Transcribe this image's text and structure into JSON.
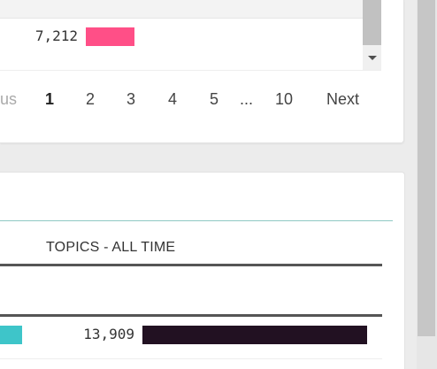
{
  "top_table": {
    "row": {
      "value": "7,212",
      "bar_fraction": 0.12,
      "bar_color": "#ff4f87"
    }
  },
  "pagination": {
    "previous_label": "us",
    "pages": [
      "1",
      "2",
      "3",
      "4",
      "5"
    ],
    "ellipsis": "...",
    "last_page": "10",
    "current_page": "1",
    "next_label": "Next"
  },
  "bottom_table": {
    "column_header": "TOPICS - ALL TIME",
    "row": {
      "value": "13,909",
      "left_bar_color": "#3ec5c9",
      "bar_fraction": 1.0,
      "bar_color": "#221122"
    }
  },
  "colors": {
    "accent_line": "#8fc9c3",
    "background": "#ececec",
    "card": "#ffffff"
  },
  "icons": {
    "scroll_down": "chevron-down-icon"
  }
}
